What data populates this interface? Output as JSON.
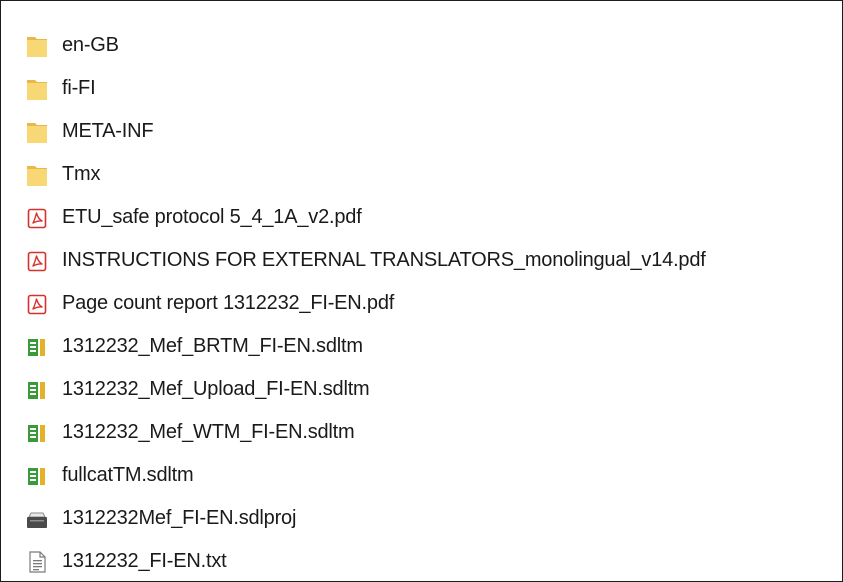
{
  "explorer": {
    "items": [
      {
        "name": "en-GB",
        "icon": "folder-icon"
      },
      {
        "name": "fi-FI",
        "icon": "folder-icon"
      },
      {
        "name": "META-INF",
        "icon": "folder-icon"
      },
      {
        "name": "Tmx",
        "icon": "folder-icon"
      },
      {
        "name": "ETU_safe protocol 5_4_1A_v2.pdf",
        "icon": "pdf-icon"
      },
      {
        "name": "INSTRUCTIONS FOR EXTERNAL TRANSLATORS_monolingual_v14.pdf",
        "icon": "pdf-icon"
      },
      {
        "name": "Page count report 1312232_FI-EN.pdf",
        "icon": "pdf-icon"
      },
      {
        "name": "1312232_Mef_BRTM_FI-EN.sdltm",
        "icon": "sdltm-icon"
      },
      {
        "name": "1312232_Mef_Upload_FI-EN.sdltm",
        "icon": "sdltm-icon"
      },
      {
        "name": "1312232_Mef_WTM_FI-EN.sdltm",
        "icon": "sdltm-icon"
      },
      {
        "name": "fullcatTM.sdltm",
        "icon": "sdltm-icon"
      },
      {
        "name": "1312232Mef_FI-EN.sdlproj",
        "icon": "sdlproj-icon"
      },
      {
        "name": "1312232_FI-EN.txt",
        "icon": "text-file-icon"
      }
    ]
  },
  "colors": {
    "folder": "#f8d775",
    "folder_tab": "#e8b84a",
    "pdf_red": "#d8312b",
    "sdltm_green": "#3a9a3a",
    "sdltm_yellow": "#e3b22b",
    "text": "#1a1a1a"
  }
}
